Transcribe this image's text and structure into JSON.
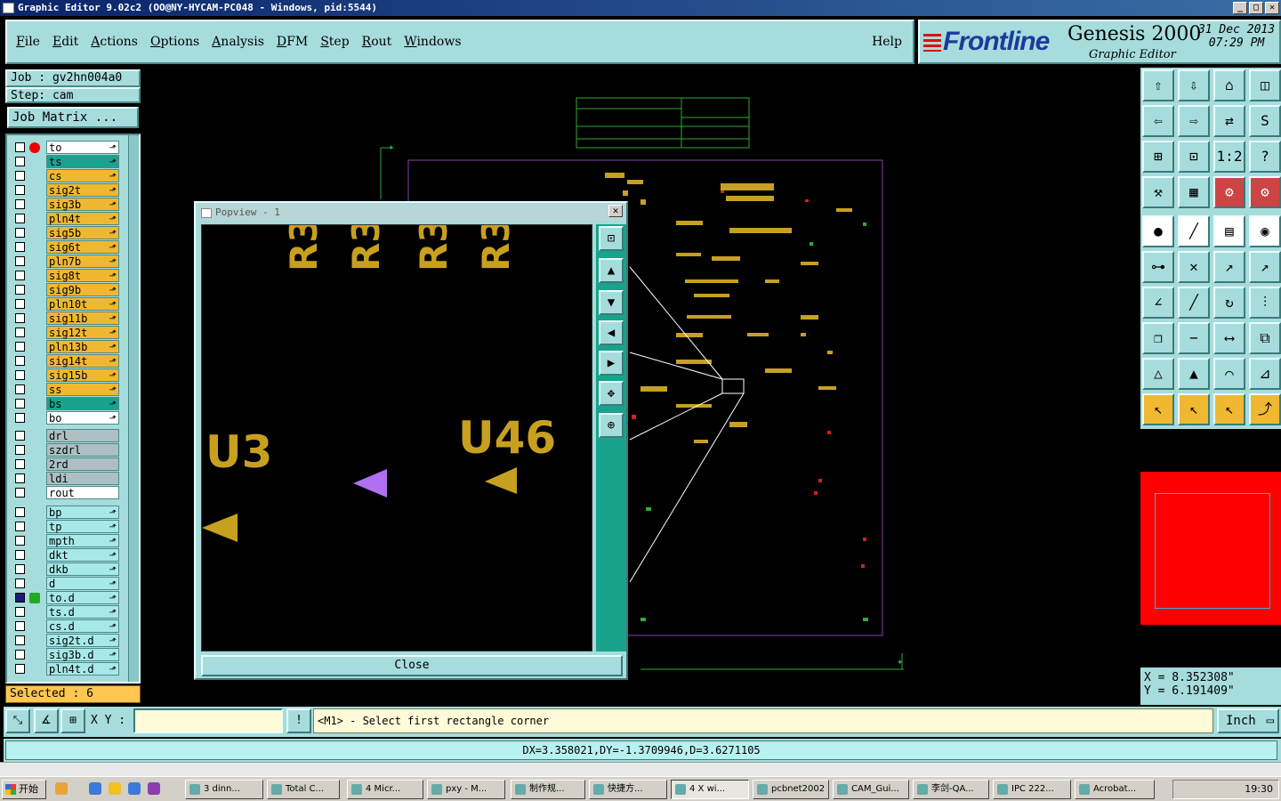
{
  "window": {
    "title": "Graphic Editor 9.02c2 (OO@NY-HYCAM-PC048 - Windows, pid:5544)"
  },
  "menu": {
    "items": [
      "File",
      "Edit",
      "Actions",
      "Options",
      "Analysis",
      "DFM",
      "Step",
      "Rout",
      "Windows"
    ],
    "help": "Help"
  },
  "logo": {
    "brand": "Frontline",
    "product": "Genesis 2000",
    "subtitle": "Graphic Editor",
    "date": "31 Dec 2013",
    "time": "07:29 PM"
  },
  "job": {
    "label": "Job : gv2hn004a0",
    "step": "Step: cam",
    "matrix_button": "Job Matrix ..."
  },
  "layers": {
    "group1": [
      {
        "name": "to",
        "color": "white"
      },
      {
        "name": "ts",
        "color": "teal"
      },
      {
        "name": "cs",
        "color": "gold"
      },
      {
        "name": "sig2t",
        "color": "gold"
      },
      {
        "name": "sig3b",
        "color": "gold"
      },
      {
        "name": "pln4t",
        "color": "gold"
      },
      {
        "name": "sig5b",
        "color": "gold"
      },
      {
        "name": "sig6t",
        "color": "gold"
      },
      {
        "name": "pln7b",
        "color": "gold"
      },
      {
        "name": "sig8t",
        "color": "gold"
      },
      {
        "name": "sig9b",
        "color": "gold"
      },
      {
        "name": "pln10t",
        "color": "gold"
      },
      {
        "name": "sig11b",
        "color": "gold"
      },
      {
        "name": "sig12t",
        "color": "gold"
      },
      {
        "name": "pln13b",
        "color": "gold"
      },
      {
        "name": "sig14t",
        "color": "gold"
      },
      {
        "name": "sig15b",
        "color": "gold"
      },
      {
        "name": "ss",
        "color": "gold"
      },
      {
        "name": "bs",
        "color": "teal"
      },
      {
        "name": "bo",
        "color": "white"
      }
    ],
    "group2": [
      {
        "name": "drl",
        "color": "grey"
      },
      {
        "name": "szdrl",
        "color": "grey"
      },
      {
        "name": "2rd",
        "color": "grey"
      },
      {
        "name": "ldi",
        "color": "grey"
      },
      {
        "name": "rout",
        "color": "grey-light"
      }
    ],
    "group3": [
      {
        "name": "bp",
        "color": "cyan"
      },
      {
        "name": "tp",
        "color": "cyan"
      },
      {
        "name": "mpth",
        "color": "cyan"
      },
      {
        "name": "dkt",
        "color": "cyan"
      },
      {
        "name": "dkb",
        "color": "cyan"
      },
      {
        "name": "d",
        "color": "cyan"
      },
      {
        "name": "to.d",
        "color": "cyan"
      },
      {
        "name": "ts.d",
        "color": "cyan"
      },
      {
        "name": "cs.d",
        "color": "cyan"
      },
      {
        "name": "sig2t.d",
        "color": "cyan"
      },
      {
        "name": "sig3b.d",
        "color": "cyan"
      },
      {
        "name": "pln4t.d",
        "color": "cyan"
      }
    ]
  },
  "selected": "Selected : 6",
  "popview": {
    "title": "Popview - 1",
    "close_button": "Close",
    "labels": {
      "r1": "R3",
      "r2": "R3",
      "r3": "R3",
      "r4": "R3",
      "u3": "U3",
      "u46": "U46"
    }
  },
  "coords": {
    "x": "X = 8.352308\"",
    "y": "Y = 6.191409\""
  },
  "bottom": {
    "xy_label": "X Y :",
    "xy_value": "",
    "message": "<M1> - Select first rectangle corner",
    "units": "Inch",
    "measure": "DX=3.358021,DY=-1.3709946,D=3.6271105"
  },
  "taskbar": {
    "start": "开始",
    "tasks": [
      "3 dinn...",
      "Total C...",
      "4 Micr...",
      "pxy - M...",
      "制作规...",
      "快捷方...",
      "4 X wi...",
      "pcbnet2002",
      "CAM_Gui...",
      "李剑-QA...",
      "IPC 222...",
      "Acrobat..."
    ],
    "clock": "19:30"
  },
  "colors": {
    "panel": "#a7dcdc",
    "teal": "#1aa38c",
    "gold": "#f0b830",
    "board_outline": "#8a3fb0",
    "highlight": "#ff0000"
  }
}
